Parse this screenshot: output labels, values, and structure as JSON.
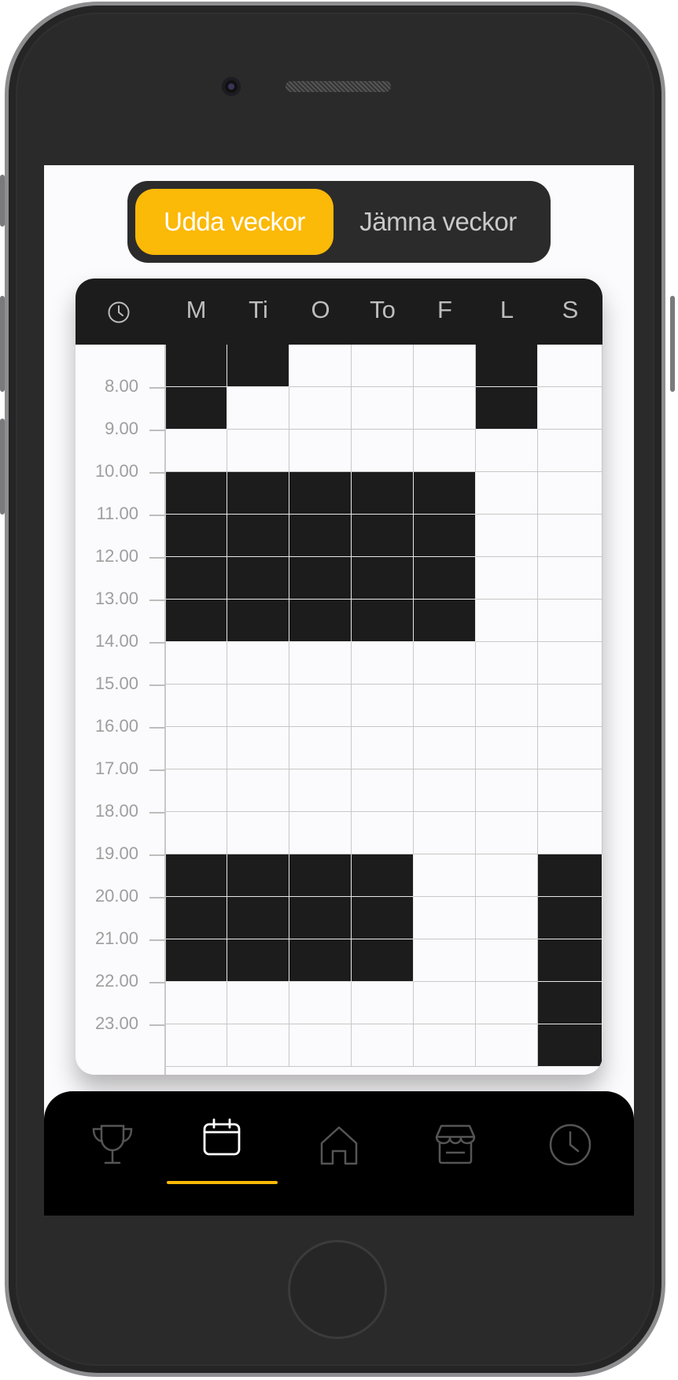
{
  "week_toggle": {
    "odd_label": "Udda veckor",
    "even_label": "Jämna veckor",
    "selected": "Udda veckor"
  },
  "schedule": {
    "days": [
      "M",
      "Ti",
      "O",
      "To",
      "F",
      "L",
      "S"
    ],
    "hours": [
      "8.00",
      "9.00",
      "10.00",
      "11.00",
      "12.00",
      "13.00",
      "14.00",
      "15.00",
      "16.00",
      "17.00",
      "18.00",
      "19.00",
      "20.00",
      "21.00",
      "22.00",
      "23.00"
    ],
    "busy_slots_by_day": [
      [
        0,
        1,
        3,
        4,
        5,
        6,
        12,
        13,
        14
      ],
      [
        0,
        3,
        4,
        5,
        6,
        12,
        13,
        14
      ],
      [
        3,
        4,
        5,
        6,
        12,
        13,
        14
      ],
      [
        3,
        4,
        5,
        6,
        12,
        13,
        14
      ],
      [
        3,
        4,
        5,
        6
      ],
      [
        0,
        1
      ],
      [
        12,
        13,
        14,
        15,
        16
      ]
    ],
    "slot_count": 17
  },
  "colors": {
    "accent": "#fbb908",
    "busy": "#1c1c1c",
    "free": "#fbfafc",
    "nav_background": "#000000"
  },
  "bottom_nav": {
    "items": [
      "trophy-icon",
      "calendar-icon",
      "home-icon",
      "store-icon",
      "clock-icon"
    ],
    "active": "calendar-icon"
  }
}
